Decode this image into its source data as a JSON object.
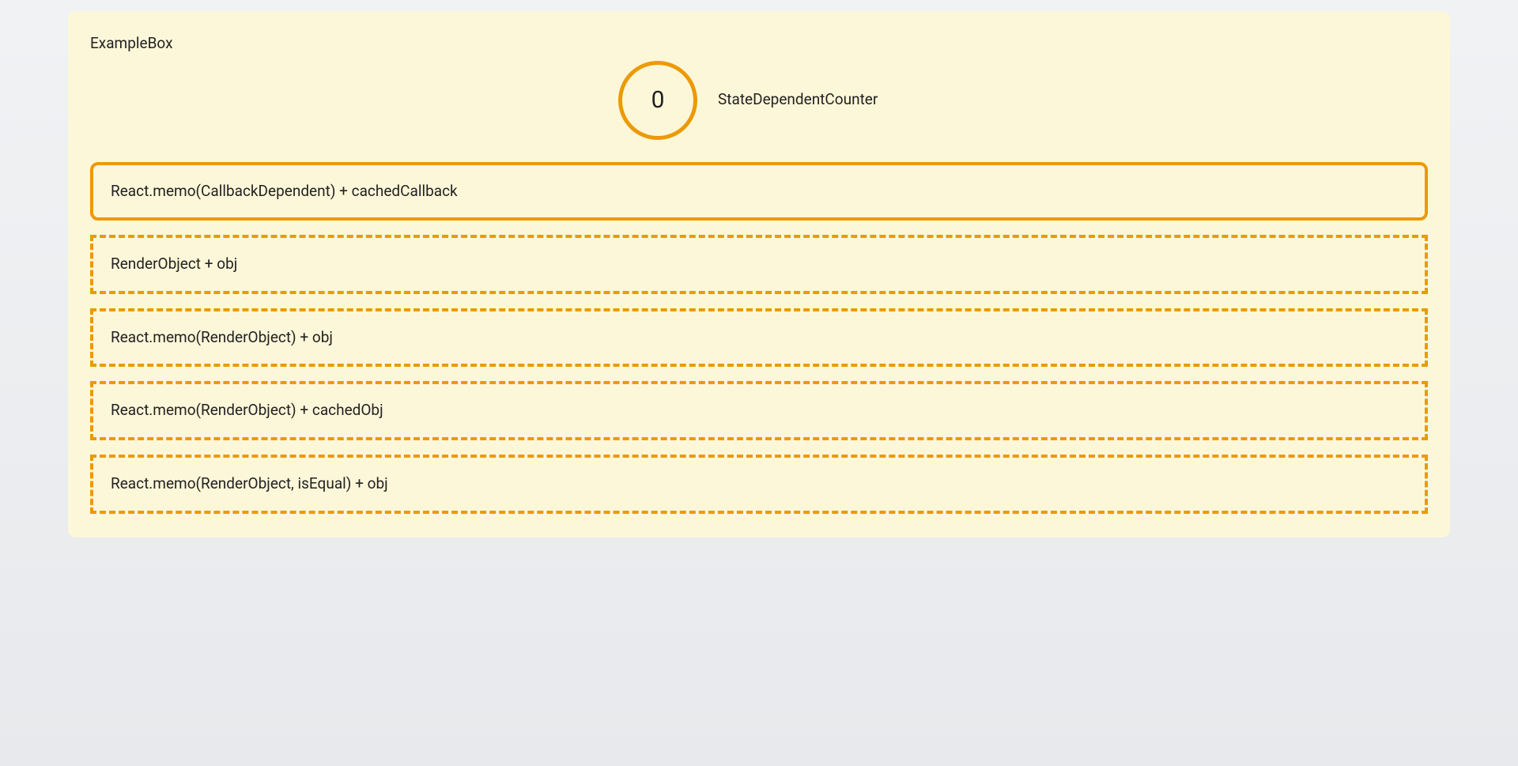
{
  "colors": {
    "accent": "#eb9a06",
    "panel_bg": "#fdf7d9"
  },
  "example": {
    "title": "ExampleBox",
    "counter": {
      "value": "0",
      "label": "StateDependentCounter"
    },
    "rows": [
      {
        "label": "React.memo(CallbackDependent) + cachedCallback",
        "style": "solid"
      },
      {
        "label": "RenderObject + obj",
        "style": "dashed"
      },
      {
        "label": "React.memo(RenderObject) + obj",
        "style": "dashed"
      },
      {
        "label": "React.memo(RenderObject) + cachedObj",
        "style": "dashed"
      },
      {
        "label": "React.memo(RenderObject, isEqual) + obj",
        "style": "dashed"
      }
    ]
  }
}
